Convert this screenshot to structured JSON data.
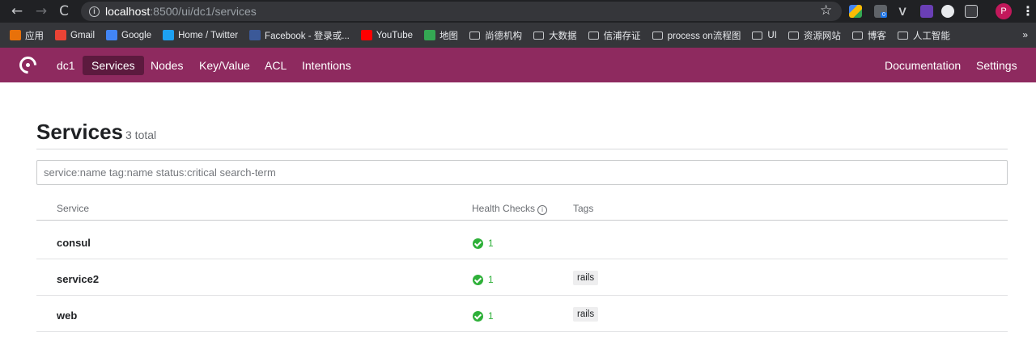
{
  "browser": {
    "url_host": "localhost",
    "url_rest": ":8500/ui/dc1/services",
    "profile_initial": "P",
    "extension_badge": "0",
    "bookmarks": [
      {
        "label": "应用",
        "icon": "apps-grid-icon",
        "color": "#e8710a"
      },
      {
        "label": "Gmail",
        "icon": "gmail-icon",
        "color": "#ea4335"
      },
      {
        "label": "Google",
        "icon": "google-icon",
        "color": "#4285f4"
      },
      {
        "label": "Home / Twitter",
        "icon": "twitter-icon",
        "color": "#1da1f2"
      },
      {
        "label": "Facebook - 登录或...",
        "icon": "facebook-icon",
        "color": "#3b5998"
      },
      {
        "label": "YouTube",
        "icon": "youtube-icon",
        "color": "#ff0000"
      },
      {
        "label": "地图",
        "icon": "maps-icon",
        "color": "#34a853"
      },
      {
        "label": "尚德机构",
        "icon": "folder-icon"
      },
      {
        "label": "大数据",
        "icon": "folder-icon"
      },
      {
        "label": "信浦存证",
        "icon": "folder-icon"
      },
      {
        "label": "process on流程图",
        "icon": "folder-icon"
      },
      {
        "label": "UI",
        "icon": "folder-icon"
      },
      {
        "label": "资源网站",
        "icon": "folder-icon"
      },
      {
        "label": "博客",
        "icon": "folder-icon"
      },
      {
        "label": "人工智能",
        "icon": "folder-icon"
      }
    ],
    "more": "»"
  },
  "nav": {
    "datacenter": "dc1",
    "items": [
      "Services",
      "Nodes",
      "Key/Value",
      "ACL",
      "Intentions"
    ],
    "right_items": [
      "Documentation",
      "Settings"
    ],
    "active": "Services",
    "brand_color": "#8e2a5f"
  },
  "page": {
    "title": "Services",
    "count": "3 total",
    "search_placeholder": "service:name tag:name status:critical search-term"
  },
  "table": {
    "columns": [
      "Service",
      "Health Checks",
      "Tags"
    ],
    "rows": [
      {
        "name": "consul",
        "passing": "1",
        "tags": ""
      },
      {
        "name": "service2",
        "passing": "1",
        "tags": "rails"
      },
      {
        "name": "web",
        "passing": "1",
        "tags": "rails"
      }
    ]
  }
}
